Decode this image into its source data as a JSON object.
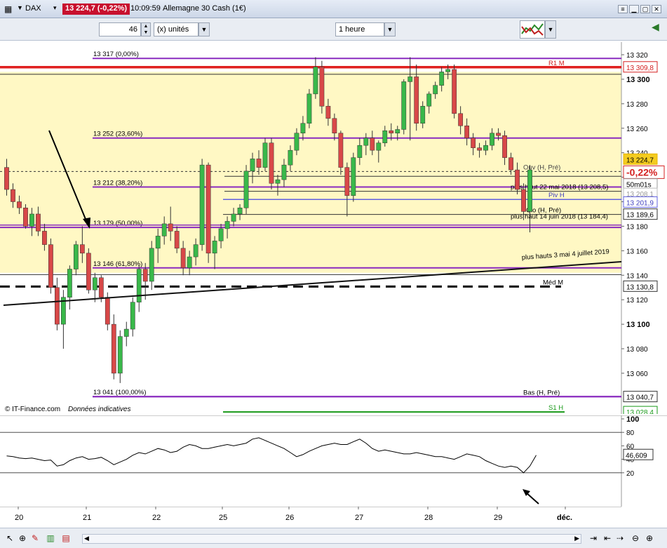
{
  "titlebar": {
    "ticker": "DAX",
    "quote": "13 224,7 (-0,22%)",
    "time": "10:09:59",
    "instrument": "Allemagne 30 Cash (1€)"
  },
  "toolbar": {
    "units_value": "46",
    "units_label": "(x) unités",
    "timeframe": "1 heure"
  },
  "price_axis": {
    "ticks": [
      "13 320",
      "13 300",
      "13 280",
      "13 260",
      "13 240",
      "13 220",
      "13 200",
      "13 180",
      "13 160",
      "13 140",
      "13 120",
      "13 100",
      "13 080",
      "13 060"
    ],
    "price_badges": [
      {
        "label": "13 309,8",
        "color": "#d42020",
        "text": "#d42020"
      },
      {
        "label": "13 224,7",
        "color": "#e8b400",
        "text": "#000000"
      },
      {
        "label": "-0,22%",
        "color": "#d42020",
        "text": "#d42020"
      },
      {
        "label": "50m01s",
        "color": "#999999",
        "text": "#000000"
      },
      {
        "label": "13 208,1",
        "color": "#bbbbbb",
        "text": "#999999"
      },
      {
        "label": "13 201,9",
        "color": "#6060e0",
        "text": "#4040c0"
      },
      {
        "label": "13 189,6",
        "color": "#333333",
        "text": "#000000"
      },
      {
        "label": "13 130,8",
        "color": "#333333",
        "text": "#000000"
      },
      {
        "label": "13 040,7",
        "color": "#333333",
        "text": "#000000"
      },
      {
        "label": "13 028,4",
        "color": "#1a9a1a",
        "text": "#1a9a1a"
      }
    ]
  },
  "fib_labels": [
    "13 317 (0,00%)",
    "13 252 (23,60%)",
    "13 212 (38,20%)",
    "13 179 (50,00%)",
    "13 146 (61,80%)",
    "13 041 (100,00%)"
  ],
  "line_labels": {
    "r1": "R1 M",
    "ouv": "Ouv (H, Pré)",
    "high22": "plus haut 22 mai 2018 (13 208,5)",
    "piv": "Piv H",
    "clo": "Clo (H, Pré)",
    "high14": "plus haut 14 juin 2018 (13 184,4)",
    "trend": "plus hauts 3 mai 4 juillet 2019",
    "med": "Méd M",
    "bas": "Bas (H, Pré)",
    "s1": "S1 H"
  },
  "credits": {
    "source": "© IT-Finance.com",
    "note": "Données indicatives"
  },
  "indicator": {
    "ticks": [
      "100",
      "80",
      "60",
      "40",
      "20"
    ],
    "value": "46,609"
  },
  "x_axis": [
    "20",
    "21",
    "22",
    "25",
    "26",
    "27",
    "28",
    "29",
    "déc."
  ],
  "chart_data": {
    "type": "candlestick",
    "timeframe": "1 heure",
    "y_range": [
      13040,
      13325
    ],
    "x_labels": [
      "20",
      "21",
      "22",
      "25",
      "26",
      "27",
      "28",
      "29",
      "déc."
    ],
    "last_price": 13224.7,
    "change_pct": -0.22,
    "fibonacci": [
      {
        "label": "13 317 (0,00%)",
        "value": 13317
      },
      {
        "label": "13 252 (23,60%)",
        "value": 13252
      },
      {
        "label": "13 212 (38,20%)",
        "value": 13212
      },
      {
        "label": "13 179 (50,00%)",
        "value": 13179
      },
      {
        "label": "13 146 (61,80%)",
        "value": 13146
      },
      {
        "label": "13 041 (100,00%)",
        "value": 13041
      }
    ],
    "levels": [
      {
        "name": "R1 M",
        "value": 13309.8
      },
      {
        "name": "Ouv (H, Pré)",
        "value": 13224.7
      },
      {
        "name": "plus haut 22 mai 2018",
        "value": 13208.5
      },
      {
        "name": "Piv H",
        "value": 13201.9
      },
      {
        "name": "Clo (H, Pré)",
        "value": 13189.6
      },
      {
        "name": "plus haut 14 juin 2018",
        "value": 13184.4
      },
      {
        "name": "Méd M",
        "value": 13130.8
      },
      {
        "name": "Bas (H, Pré)",
        "value": 13040.7
      },
      {
        "name": "S1 H",
        "value": 13028.4
      }
    ],
    "candles": [
      [
        13228,
        13235,
        13205,
        13210
      ],
      [
        13210,
        13215,
        13195,
        13200
      ],
      [
        13200,
        13205,
        13190,
        13195
      ],
      [
        13195,
        13198,
        13178,
        13180
      ],
      [
        13180,
        13195,
        13172,
        13190
      ],
      [
        13190,
        13196,
        13172,
        13176
      ],
      [
        13176,
        13182,
        13160,
        13165
      ],
      [
        13165,
        13170,
        13125,
        13130
      ],
      [
        13130,
        13138,
        13095,
        13100
      ],
      [
        13100,
        13128,
        13080,
        13122
      ],
      [
        13122,
        13148,
        13112,
        13145
      ],
      [
        13145,
        13168,
        13140,
        13165
      ],
      [
        13165,
        13180,
        13150,
        13158
      ],
      [
        13158,
        13162,
        13125,
        13128
      ],
      [
        13128,
        13142,
        13118,
        13138
      ],
      [
        13138,
        13140,
        13118,
        13122
      ],
      [
        13122,
        13126,
        13095,
        13100
      ],
      [
        13100,
        13108,
        13055,
        13060
      ],
      [
        13060,
        13095,
        13052,
        13090
      ],
      [
        13090,
        13102,
        13082,
        13096
      ],
      [
        13096,
        13122,
        13090,
        13118
      ],
      [
        13118,
        13148,
        13110,
        13145
      ],
      [
        13145,
        13150,
        13120,
        13135
      ],
      [
        13135,
        13168,
        13128,
        13162
      ],
      [
        13162,
        13178,
        13150,
        13172
      ],
      [
        13172,
        13188,
        13165,
        13182
      ],
      [
        13182,
        13196,
        13168,
        13176
      ],
      [
        13176,
        13180,
        13158,
        13162
      ],
      [
        13162,
        13168,
        13140,
        13146
      ],
      [
        13146,
        13160,
        13140,
        13155
      ],
      [
        13155,
        13170,
        13148,
        13165
      ],
      [
        13165,
        13235,
        13160,
        13230
      ],
      [
        13230,
        13232,
        13150,
        13158
      ],
      [
        13158,
        13172,
        13145,
        13168
      ],
      [
        13168,
        13182,
        13162,
        13178
      ],
      [
        13178,
        13188,
        13170,
        13184
      ],
      [
        13184,
        13195,
        13180,
        13190
      ],
      [
        13190,
        13198,
        13185,
        13195
      ],
      [
        13195,
        13230,
        13190,
        13225
      ],
      [
        13225,
        13240,
        13215,
        13235
      ],
      [
        13235,
        13242,
        13222,
        13228
      ],
      [
        13228,
        13252,
        13225,
        13248
      ],
      [
        13248,
        13252,
        13210,
        13215
      ],
      [
        13215,
        13222,
        13205,
        13218
      ],
      [
        13218,
        13235,
        13212,
        13230
      ],
      [
        13230,
        13246,
        13225,
        13242
      ],
      [
        13242,
        13260,
        13238,
        13256
      ],
      [
        13256,
        13270,
        13250,
        13264
      ],
      [
        13264,
        13292,
        13260,
        13288
      ],
      [
        13288,
        13318,
        13284,
        13310
      ],
      [
        13310,
        13315,
        13272,
        13278
      ],
      [
        13278,
        13284,
        13262,
        13268
      ],
      [
        13268,
        13272,
        13250,
        13256
      ],
      [
        13256,
        13258,
        13222,
        13228
      ],
      [
        13228,
        13232,
        13188,
        13205
      ],
      [
        13205,
        13240,
        13200,
        13236
      ],
      [
        13236,
        13252,
        13230,
        13246
      ],
      [
        13246,
        13256,
        13238,
        13252
      ],
      [
        13252,
        13258,
        13238,
        13242
      ],
      [
        13242,
        13250,
        13232,
        13248
      ],
      [
        13248,
        13262,
        13245,
        13258
      ],
      [
        13258,
        13264,
        13250,
        13256
      ],
      [
        13256,
        13262,
        13250,
        13259
      ],
      [
        13259,
        13300,
        13255,
        13298
      ],
      [
        13298,
        13318,
        13250,
        13302
      ],
      [
        13302,
        13312,
        13258,
        13264
      ],
      [
        13264,
        13282,
        13260,
        13278
      ],
      [
        13278,
        13290,
        13272,
        13288
      ],
      [
        13288,
        13298,
        13284,
        13295
      ],
      [
        13295,
        13310,
        13290,
        13306
      ],
      [
        13306,
        13312,
        13300,
        13308
      ],
      [
        13308,
        13312,
        13268,
        13272
      ],
      [
        13272,
        13278,
        13255,
        13262
      ],
      [
        13262,
        13268,
        13246,
        13252
      ],
      [
        13252,
        13256,
        13238,
        13244
      ],
      [
        13244,
        13248,
        13236,
        13242
      ],
      [
        13242,
        13250,
        13238,
        13246
      ],
      [
        13246,
        13260,
        13242,
        13256
      ],
      [
        13256,
        13260,
        13250,
        13254
      ],
      [
        13254,
        13258,
        13230,
        13236
      ],
      [
        13236,
        13240,
        13222,
        13226
      ],
      [
        13226,
        13232,
        13206,
        13210
      ],
      [
        13210,
        13215,
        13185,
        13192
      ],
      [
        13192,
        13230,
        13175,
        13226
      ]
    ],
    "indicator": {
      "range": [
        0,
        100
      ],
      "last_value": 46.609,
      "levels": [
        80,
        20
      ],
      "values": [
        45,
        44,
        42,
        41,
        42,
        40,
        38,
        39,
        30,
        32,
        38,
        42,
        44,
        40,
        41,
        43,
        38,
        32,
        36,
        40,
        46,
        50,
        48,
        52,
        56,
        54,
        50,
        52,
        58,
        62,
        60,
        56,
        56,
        58,
        60,
        62,
        60,
        62,
        64,
        70,
        72,
        68,
        64,
        60,
        56,
        50,
        44,
        47,
        52,
        56,
        60,
        62,
        64,
        62,
        62,
        66,
        70,
        64,
        56,
        52,
        54,
        52,
        50,
        48,
        48,
        50,
        48,
        46,
        44,
        44,
        42,
        40,
        44,
        48,
        46,
        44,
        38,
        34,
        30,
        28,
        30,
        28,
        20,
        30,
        46
      ]
    }
  }
}
